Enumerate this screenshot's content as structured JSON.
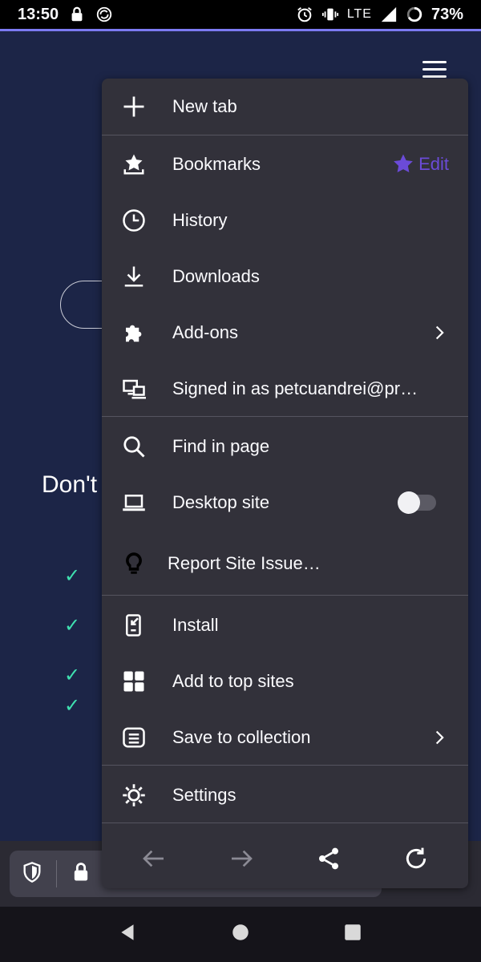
{
  "status_bar": {
    "time": "13:50",
    "network": "LTE",
    "battery": "73%"
  },
  "page": {
    "heading": "Don't",
    "check_glyph": "✓"
  },
  "menu": {
    "items": [
      {
        "label": "New tab",
        "icon": "plus-icon"
      },
      {
        "label": "Bookmarks",
        "icon": "bookmarks-icon",
        "action_label": "Edit",
        "action_icon": "star-icon"
      },
      {
        "label": "History",
        "icon": "clock-icon"
      },
      {
        "label": "Downloads",
        "icon": "download-icon"
      },
      {
        "label": "Add-ons",
        "icon": "puzzle-icon"
      },
      {
        "label": "Signed in as petcuandrei@pr…",
        "icon": "devices-icon"
      },
      {
        "label": "Find in page",
        "icon": "search-icon"
      },
      {
        "label": "Desktop site",
        "icon": "laptop-icon",
        "toggle_on": false
      },
      {
        "label": "Report Site Issue…",
        "icon": "lightbulb-icon"
      },
      {
        "label": "Install",
        "icon": "install-icon"
      },
      {
        "label": "Add to top sites",
        "icon": "grid-icon"
      },
      {
        "label": "Save to collection",
        "icon": "collection-icon"
      },
      {
        "label": "Settings",
        "icon": "gear-icon"
      }
    ]
  },
  "colors": {
    "accent": "#6b4bd8",
    "menu_bg": "#32313a",
    "page_bg": "#1c2547",
    "check": "#3fe1b0"
  }
}
